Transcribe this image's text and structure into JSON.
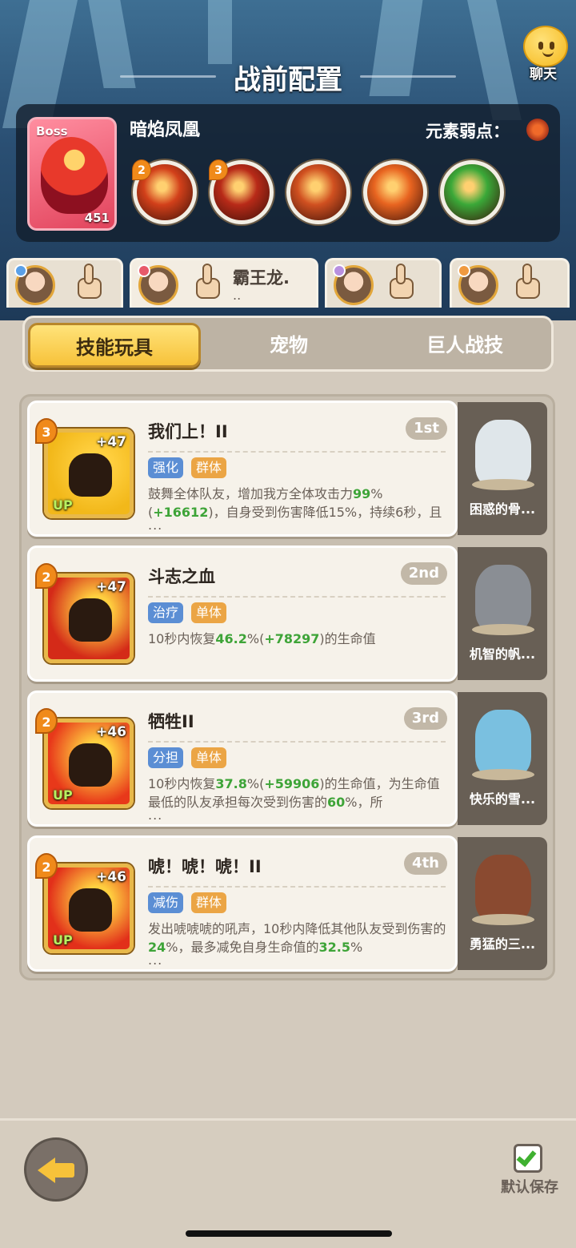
{
  "header": {
    "title": "战前配置",
    "chat_label": "聊天"
  },
  "boss": {
    "tag": "Boss",
    "level": "451",
    "name": "暗焰凤凰",
    "weakness_label": "元素弱点：",
    "skills": [
      {
        "level": "2",
        "color": "#d2401a"
      },
      {
        "level": "3",
        "color": "#b82a18"
      },
      {
        "level": "",
        "color": "#d05020"
      },
      {
        "level": "",
        "color": "#e86420"
      },
      {
        "level": "",
        "color": "#3aa838"
      }
    ]
  },
  "heroes": [
    {
      "name": "",
      "dots": "",
      "badge": "#5aa0e8"
    },
    {
      "name": "霸王龙.",
      "dots": "..",
      "badge": "#e85a6a"
    },
    {
      "name": "",
      "dots": "",
      "badge": "#b890e0"
    },
    {
      "name": "",
      "dots": "",
      "badge": "#f09a40"
    }
  ],
  "tabs": [
    "技能玩具",
    "宠物",
    "巨人战技"
  ],
  "skills": [
    {
      "level": "3",
      "plus": "+47",
      "up": "UP",
      "title": "我们上！II",
      "rank": "1st",
      "tags": [
        "强化",
        "群体"
      ],
      "desc_a": "鼓舞全体队友，增加我方全体攻击力",
      "hl1": "99",
      "desc_b": "%(",
      "hl2": "+16612",
      "desc_c": ")，自身受到伤害降低15%，持续6秒，且",
      "ellipsis": "...",
      "pet": "困惑的骨...",
      "icon_bg": "#f2b81a",
      "pet_color": "#dfe6ea"
    },
    {
      "level": "2",
      "plus": "+47",
      "up": "",
      "title": "斗志之血",
      "rank": "2nd",
      "tags": [
        "治疗",
        "单体"
      ],
      "desc_a": "10秒内恢复",
      "hl1": "46.2",
      "desc_b": "%(",
      "hl2": "+78297",
      "desc_c": ")的生命值",
      "ellipsis": "",
      "pet": "机智的帆...",
      "icon_bg": "#d42a18",
      "pet_color": "#8a8e94"
    },
    {
      "level": "2",
      "plus": "+46",
      "up": "UP",
      "title": "牺牲II",
      "rank": "3rd",
      "tags": [
        "分担",
        "单体"
      ],
      "desc_a": "10秒内恢复",
      "hl1": "37.8",
      "desc_b": "%(",
      "hl2": "+59906",
      "desc_c": ")的生命值，为生命值最低的队友承担每次受到伤害的",
      "hl3": "60",
      "desc_d": "%，所",
      "ellipsis": "...",
      "pet": "快乐的雪...",
      "icon_bg": "#e8381a",
      "pet_color": "#7ac0e0"
    },
    {
      "level": "2",
      "plus": "+46",
      "up": "UP",
      "title": "唬！唬！唬！II",
      "rank": "4th",
      "tags": [
        "减伤",
        "群体"
      ],
      "desc_a": "发出唬唬唬的吼声，10秒内降低其他队友受到伤害的",
      "hl1": "24",
      "desc_b": "%，最多减免自身生命值的",
      "hl2": "32.5",
      "desc_c": "%",
      "ellipsis": "...",
      "pet": "勇猛的三...",
      "icon_bg": "#e2301a",
      "pet_color": "#8a4a30"
    }
  ],
  "bottom": {
    "save_label": "默认保存"
  }
}
